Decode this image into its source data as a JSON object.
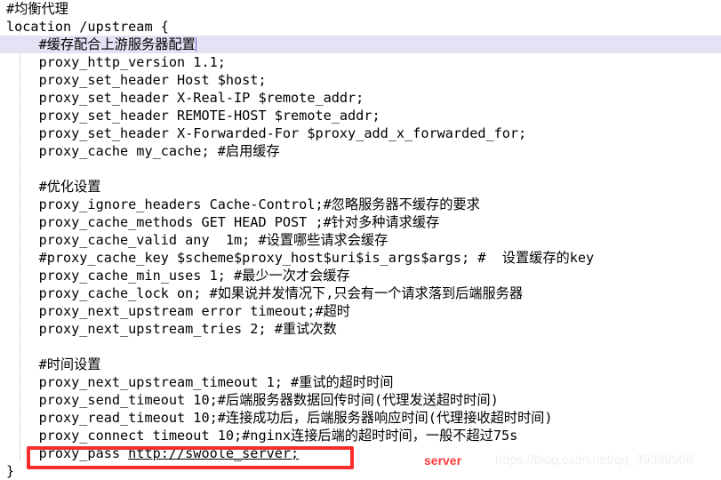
{
  "editor": {
    "language": "nginx",
    "background_color": "#ffffff",
    "text_color": "#000000",
    "highlight_color": "#e4e2f4",
    "cursor_color": "#7a5fd3",
    "indent_guide_color": "#b9b9b9"
  },
  "code_lines": [
    {
      "text": "#均衡代理",
      "highlight": false
    },
    {
      "text": "location /upstream {",
      "highlight": false
    },
    {
      "text": "    #缓存配合上游服务器配置",
      "highlight": true,
      "cursor": true
    },
    {
      "text": "    proxy_http_version 1.1;",
      "highlight": false
    },
    {
      "text": "    proxy_set_header Host $host;",
      "highlight": false
    },
    {
      "text": "    proxy_set_header X-Real-IP $remote_addr;",
      "highlight": false
    },
    {
      "text": "    proxy_set_header REMOTE-HOST $remote_addr;",
      "highlight": false
    },
    {
      "text": "    proxy_set_header X-Forwarded-For $proxy_add_x_forwarded_for;",
      "highlight": false
    },
    {
      "text": "    proxy_cache my_cache; #启用缓存",
      "highlight": false
    },
    {
      "text": "",
      "highlight": false
    },
    {
      "text": "    #优化设置",
      "highlight": false
    },
    {
      "text": "    proxy_ignore_headers Cache-Control;#忽略服务器不缓存的要求",
      "highlight": false
    },
    {
      "text": "    proxy_cache_methods GET HEAD POST ;#针对多种请求缓存",
      "highlight": false
    },
    {
      "text": "    proxy_cache_valid any  1m; #设置哪些请求会缓存",
      "highlight": false
    },
    {
      "text": "    #proxy_cache_key $scheme$proxy_host$uri$is_args$args; #  设置缓存的key",
      "highlight": false
    },
    {
      "text": "    proxy_cache_min_uses 1; #最少一次才会缓存",
      "highlight": false
    },
    {
      "text": "    proxy_cache_lock on; #如果说并发情况下,只会有一个请求落到后端服务器",
      "highlight": false
    },
    {
      "text": "    proxy_next_upstream error timeout;#超时",
      "highlight": false
    },
    {
      "text": "    proxy_next_upstream_tries 2; #重试次数",
      "highlight": false
    },
    {
      "text": "",
      "highlight": false
    },
    {
      "text": "    #时间设置",
      "highlight": false
    },
    {
      "text": "    proxy_next_upstream_timeout 1; #重试的超时时间",
      "highlight": false
    },
    {
      "text": "    proxy_send_timeout 10;#后端服务器数据回传时间(代理发送超时时间)",
      "highlight": false
    },
    {
      "text": "    proxy_read_timeout 10;#连接成功后，后端服务器响应时间(代理接收超时时间)",
      "highlight": false
    },
    {
      "text": "    proxy_connect timeout 10;#nginx连接后端的超时时间，一般不超过75s",
      "highlight": false
    },
    {
      "text": "    proxy_pass ",
      "suffix_underlined": "http://swoole_server;",
      "highlight": false
    },
    {
      "text": "}",
      "highlight": false
    }
  ],
  "annotations": {
    "red_box": {
      "label": "proxy-pass-highlight-box",
      "color": "#f92b2b"
    },
    "red_label": {
      "text": "server",
      "color": "#fd3a3a"
    }
  },
  "watermark": {
    "text": "https://blog.csdn.net/qq_39399966",
    "color": "#f0f0f0"
  }
}
